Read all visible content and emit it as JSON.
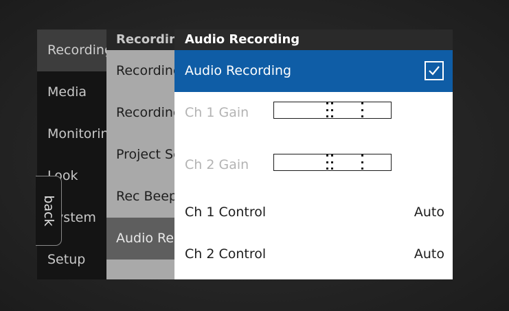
{
  "menu1": {
    "items": [
      {
        "label": "Recording"
      },
      {
        "label": "Media"
      },
      {
        "label": "Monitoring"
      },
      {
        "label": "Look"
      },
      {
        "label": "System"
      },
      {
        "label": "Setup"
      }
    ]
  },
  "menu2": {
    "title": "Recording",
    "items": [
      {
        "label": "Recording"
      },
      {
        "label": "Recording"
      },
      {
        "label": "Project Settings"
      },
      {
        "label": "Rec Beeper"
      },
      {
        "label": "Audio Recording"
      }
    ]
  },
  "panel": {
    "title": "Audio Recording",
    "audio_recording_label": "Audio Recording",
    "audio_recording_checked": true,
    "ch1_gain_label": "Ch 1 Gain",
    "ch2_gain_label": "Ch 2 Gain",
    "ch1_control_label": "Ch 1 Control",
    "ch1_control_value": "Auto",
    "ch2_control_label": "Ch 2 Control",
    "ch2_control_value": "Auto"
  },
  "back_label": "back",
  "colors": {
    "highlight": "#0f5da6",
    "menu_dark": "#141414",
    "menu_mid": "#a9a9a9"
  }
}
